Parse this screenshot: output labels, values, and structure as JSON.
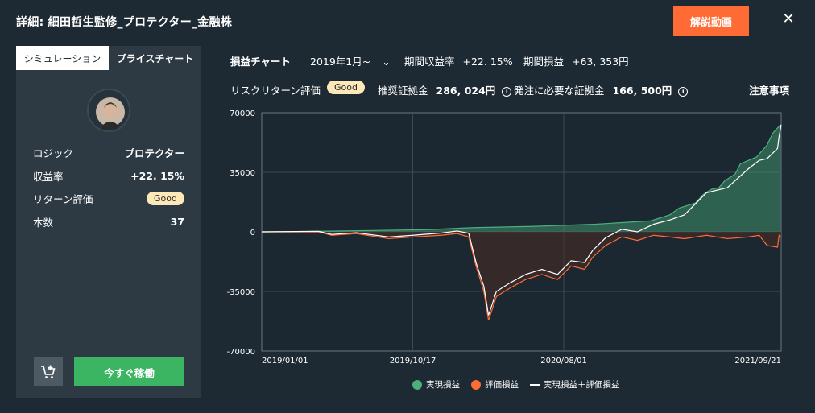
{
  "header": {
    "title": "詳細: 細田哲生監修_プロテクター_金融株",
    "video_button": "解説動画",
    "close": "✕"
  },
  "tabs": [
    {
      "label": "シミュレーション",
      "active": true
    },
    {
      "label": "プライスチャート",
      "active": false
    }
  ],
  "summary": {
    "rows": [
      {
        "label": "ロジック",
        "value": "プロテクター"
      },
      {
        "label": "収益率",
        "value": "+22. 15%"
      },
      {
        "label": "リターン評価",
        "value": "Good"
      },
      {
        "label": "本数",
        "value": "37"
      }
    ],
    "run_button": "今すぐ稼働",
    "cart_icon": "cart-add-icon"
  },
  "info": {
    "chart_label": "損益チャート",
    "period_select": "2019年1月~",
    "period_return_label": "期間収益率",
    "period_return_value": "+22. 15%",
    "period_pnl_label": "期間損益",
    "period_pnl_value": "+63, 353円",
    "risk_label": "リスクリターン評価",
    "risk_badge": "Good",
    "recommended_margin_label": "推奨証拠金",
    "recommended_margin_value": "286, 024円",
    "order_margin_label": "発注に必要な証拠金",
    "order_margin_value": "166, 500円",
    "notes_link": "注意事項"
  },
  "colors": {
    "realized": "#3f8f6b",
    "unrealized": "#ff6b35",
    "total": "#ffffff",
    "accent": "#ff6b35",
    "run": "#3cb563"
  },
  "chart_data": {
    "type": "area",
    "title": "",
    "xlabel": "",
    "ylabel": "",
    "ylim": [
      -70000,
      70000
    ],
    "y_ticks": [
      "70000",
      "35000",
      "0",
      "-35000",
      "-70000"
    ],
    "x_ticks": [
      "2019/01/01",
      "2019/10/17",
      "2020/08/01",
      "2021/09/21"
    ],
    "x_tick_dates": [
      "2019-01-01",
      "2019-10-17",
      "2020-08-01",
      "2021-09-21"
    ],
    "grid": true,
    "legend_position": "bottom",
    "series": [
      {
        "name": "実現損益",
        "points": [
          [
            "2019-01-01",
            0
          ],
          [
            "2019-04-15",
            300
          ],
          [
            "2019-08-01",
            800
          ],
          [
            "2019-11-15",
            1300
          ],
          [
            "2020-02-10",
            2500
          ],
          [
            "2020-06-01",
            3200
          ],
          [
            "2020-10-01",
            4500
          ],
          [
            "2021-01-15",
            6500
          ],
          [
            "2021-02-20",
            10000
          ],
          [
            "2021-03-10",
            14000
          ],
          [
            "2021-04-10",
            17000
          ],
          [
            "2021-04-25",
            22000
          ],
          [
            "2021-05-10",
            25000
          ],
          [
            "2021-05-25",
            26000
          ],
          [
            "2021-06-05",
            30000
          ],
          [
            "2021-06-25",
            34000
          ],
          [
            "2021-07-05",
            40000
          ],
          [
            "2021-08-05",
            44000
          ],
          [
            "2021-08-25",
            51000
          ],
          [
            "2021-09-05",
            58000
          ],
          [
            "2021-09-20",
            63000
          ]
        ]
      },
      {
        "name": "評価損益",
        "points": [
          [
            "2019-01-01",
            0
          ],
          [
            "2019-04-20",
            0
          ],
          [
            "2019-05-15",
            -2000
          ],
          [
            "2019-07-01",
            -1000
          ],
          [
            "2019-09-01",
            -4000
          ],
          [
            "2019-10-17",
            -3000
          ],
          [
            "2019-12-10",
            -2000
          ],
          [
            "2020-01-10",
            -1000
          ],
          [
            "2020-02-01",
            -3000
          ],
          [
            "2020-02-15",
            -20000
          ],
          [
            "2020-03-01",
            -35000
          ],
          [
            "2020-03-10",
            -52000
          ],
          [
            "2020-03-25",
            -38000
          ],
          [
            "2020-04-20",
            -33000
          ],
          [
            "2020-05-20",
            -28000
          ],
          [
            "2020-06-20",
            -25000
          ],
          [
            "2020-07-20",
            -28000
          ],
          [
            "2020-08-15",
            -20000
          ],
          [
            "2020-09-10",
            -22000
          ],
          [
            "2020-09-25",
            -15000
          ],
          [
            "2020-10-20",
            -8000
          ],
          [
            "2020-11-20",
            -3000
          ],
          [
            "2020-12-20",
            -5000
          ],
          [
            "2021-01-20",
            -2000
          ],
          [
            "2021-02-20",
            -3000
          ],
          [
            "2021-03-20",
            -4000
          ],
          [
            "2021-05-01",
            -2000
          ],
          [
            "2021-06-10",
            -4000
          ],
          [
            "2021-07-20",
            -3000
          ],
          [
            "2021-08-10",
            -2000
          ],
          [
            "2021-08-25",
            -8000
          ],
          [
            "2021-09-14",
            -9000
          ],
          [
            "2021-09-17",
            -2000
          ],
          [
            "2021-09-21",
            -3000
          ]
        ]
      },
      {
        "name": "実現損益＋評価損益",
        "points": [
          [
            "2019-01-01",
            0
          ],
          [
            "2019-04-20",
            300
          ],
          [
            "2019-05-15",
            -1500
          ],
          [
            "2019-07-01",
            -500
          ],
          [
            "2019-09-01",
            -3000
          ],
          [
            "2019-10-17",
            -2000
          ],
          [
            "2019-12-10",
            -700
          ],
          [
            "2020-01-10",
            500
          ],
          [
            "2020-02-01",
            -800
          ],
          [
            "2020-02-15",
            -18000
          ],
          [
            "2020-03-01",
            -32000
          ],
          [
            "2020-03-10",
            -49000
          ],
          [
            "2020-03-25",
            -35000
          ],
          [
            "2020-04-20",
            -30000
          ],
          [
            "2020-05-20",
            -25000
          ],
          [
            "2020-06-20",
            -22000
          ],
          [
            "2020-07-20",
            -25000
          ],
          [
            "2020-08-15",
            -17000
          ],
          [
            "2020-09-10",
            -18000
          ],
          [
            "2020-09-25",
            -11000
          ],
          [
            "2020-10-20",
            -3500
          ],
          [
            "2020-11-20",
            1500
          ],
          [
            "2020-12-20",
            0
          ],
          [
            "2021-01-20",
            4500
          ],
          [
            "2021-02-20",
            7000
          ],
          [
            "2021-03-20",
            10000
          ],
          [
            "2021-05-01",
            23000
          ],
          [
            "2021-06-10",
            26000
          ],
          [
            "2021-07-20",
            37000
          ],
          [
            "2021-08-10",
            42000
          ],
          [
            "2021-08-25",
            43000
          ],
          [
            "2021-09-14",
            49000
          ],
          [
            "2021-09-17",
            56000
          ],
          [
            "2021-09-21",
            63000
          ]
        ]
      }
    ]
  }
}
